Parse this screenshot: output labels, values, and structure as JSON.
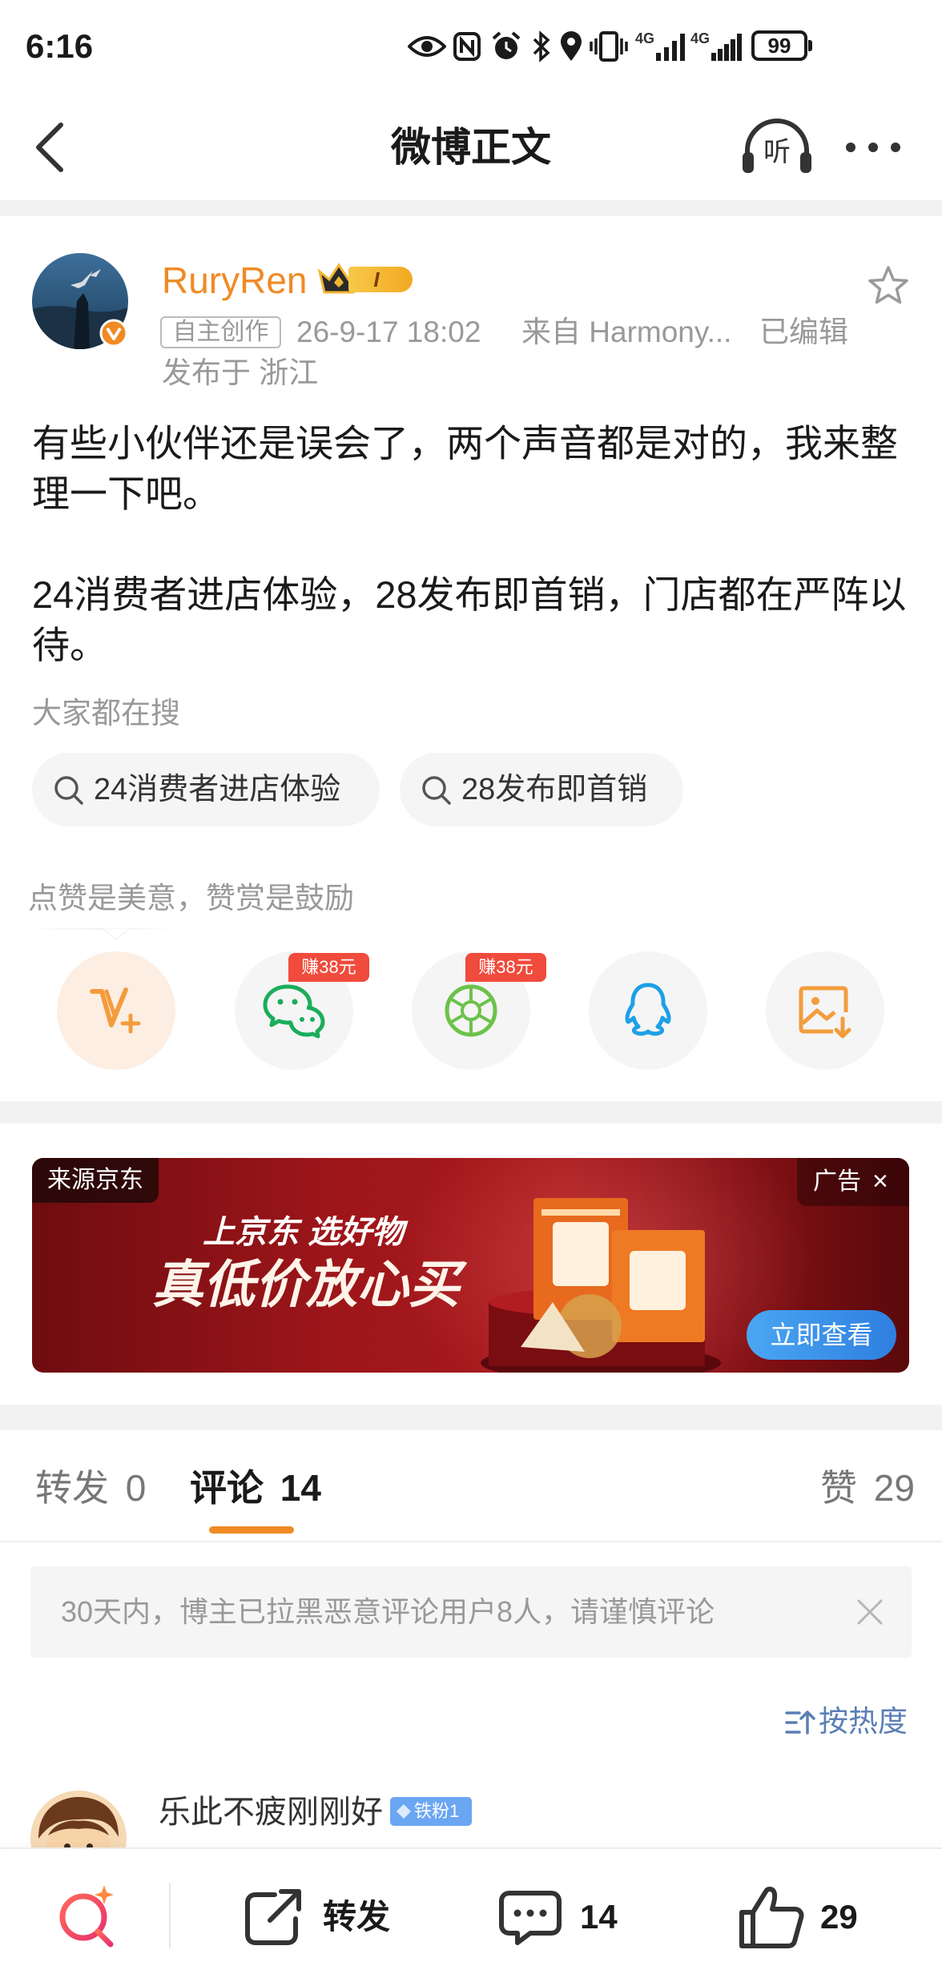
{
  "status_bar": {
    "time": "6:16",
    "network_1": "4G",
    "network_2": "4G",
    "battery": "99"
  },
  "header": {
    "title": "微博正文",
    "listen_label": "听"
  },
  "post": {
    "author": {
      "name": "RuryRen",
      "badge_level": "I"
    },
    "tag": "自主创作",
    "time": "26-9-17 18:02",
    "source": "来自 Harmony...",
    "edited": "已编辑",
    "location": "发布于 浙江",
    "paragraphs": [
      "有些小伙伴还是误会了，两个声音都是对的，我来整理一下吧。",
      "24消费者进店体验，28发布即首销，门店都在严阵以待。"
    ]
  },
  "search": {
    "title": "大家都在搜",
    "chips": [
      "24消费者进店体验",
      "28发布即首销"
    ]
  },
  "reward": {
    "caption": "点赞是美意，赞赏是鼓励",
    "buttons": [
      {
        "icon": "v-plus-icon"
      },
      {
        "icon": "wechat-icon",
        "badge": "赚38元"
      },
      {
        "icon": "moments-icon",
        "badge": "赚38元"
      },
      {
        "icon": "qq-icon"
      },
      {
        "icon": "save-image-icon"
      }
    ]
  },
  "ad": {
    "source": "来源京东",
    "ad_label": "广告",
    "close": "×",
    "headline": "上京东 选好物",
    "slogan": "真低价放心买",
    "cta": "立即查看"
  },
  "tabs": [
    {
      "label": "转发",
      "count": "0"
    },
    {
      "label": "评论",
      "count": "14"
    },
    {
      "label": "赞",
      "count": "29"
    }
  ],
  "notice": {
    "text": "30天内，博主已拉黑恶意评论用户8人，请谨慎评论",
    "close": "×"
  },
  "sort": {
    "label": "按热度"
  },
  "comments": [
    {
      "user": "乐此不疲刚刚好",
      "badge": "铁粉1"
    }
  ],
  "bottom_bar": {
    "repost": "转发",
    "comments": "14",
    "likes": "29"
  },
  "colors": {
    "accent": "#F08A24",
    "sort_link": "#5B7FB5",
    "earn_badge": "#F04B3C",
    "cta": "#3A8EE6",
    "fan_badge": "#6AA6F2"
  }
}
